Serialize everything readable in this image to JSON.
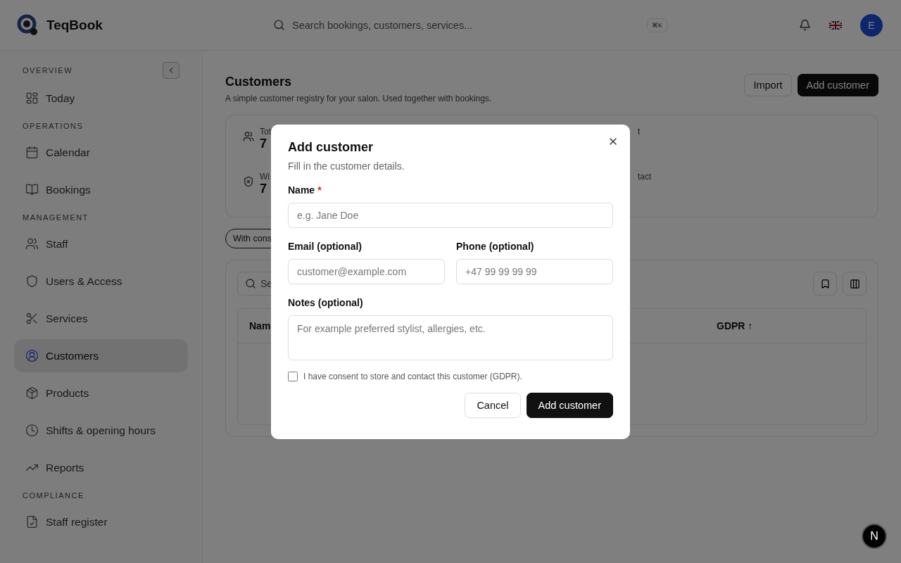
{
  "header": {
    "brand": "TeqBook",
    "search": {
      "placeholder": "Search bookings, customers, services...",
      "shortcut": "⌘K"
    },
    "avatar": "E"
  },
  "sidebar": {
    "sections": [
      {
        "title": "OVERVIEW",
        "items": [
          {
            "label": "Today",
            "selected": false
          }
        ]
      },
      {
        "title": "OPERATIONS",
        "items": [
          {
            "label": "Calendar",
            "selected": false
          },
          {
            "label": "Bookings",
            "selected": false
          }
        ]
      },
      {
        "title": "MANAGEMENT",
        "items": [
          {
            "label": "Staff",
            "selected": false
          },
          {
            "label": "Users & Access",
            "selected": false
          },
          {
            "label": "Services",
            "selected": false
          },
          {
            "label": "Customers",
            "selected": true
          },
          {
            "label": "Products",
            "selected": false
          },
          {
            "label": "Shifts & opening hours",
            "selected": false
          },
          {
            "label": "Reports",
            "selected": false
          }
        ]
      },
      {
        "title": "COMPLIANCE",
        "items": [
          {
            "label": "Staff register",
            "selected": false
          }
        ]
      }
    ]
  },
  "page": {
    "title": "Customers",
    "subtitle": "A simple customer registry for your salon. Used together with bookings.",
    "buttons": [
      "Import",
      "Add customer"
    ],
    "stats": [
      {
        "label": "Tot",
        "value": "7"
      },
      {
        "label": "t"
      },
      {
        "label": "Wi",
        "value": "7"
      },
      {
        "label": "tact"
      }
    ],
    "filter": "With cons",
    "table_search": {
      "placeholder": "Se"
    },
    "table": {
      "columns": [
        "Nam",
        "GDPR ↑"
      ]
    }
  },
  "dialog": {
    "title": "Add customer",
    "subtitle": "Fill in the customer details.",
    "fields": [
      {
        "kind": "text",
        "label": "Name",
        "required_mark": "*",
        "placeholder": "e.g. Jane Doe"
      },
      {
        "kind": "text",
        "label": "Email (optional)",
        "placeholder": "customer@example.com"
      },
      {
        "kind": "text",
        "label": "Phone (optional)",
        "placeholder": "+47 99 99 99 99"
      },
      {
        "kind": "textarea",
        "label": "Notes (optional)",
        "placeholder": "For example preferred stylist, allergies, etc."
      }
    ],
    "consent": {
      "label": "I have consent to store and contact this customer (GDPR).",
      "checked": false
    },
    "buttons": [
      {
        "label": "Cancel",
        "primary": false
      },
      {
        "label": "Add customer",
        "primary": true
      }
    ]
  },
  "dev_badge": "N"
}
